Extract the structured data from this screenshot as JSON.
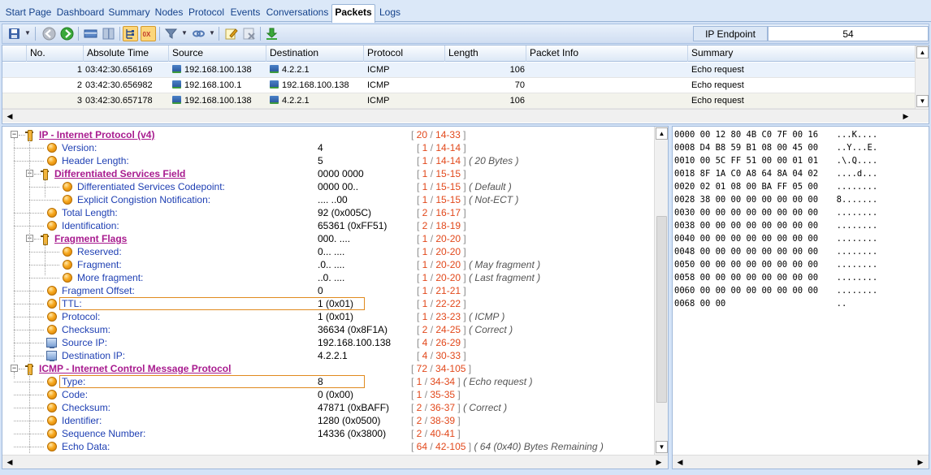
{
  "tabs": [
    {
      "label": "Start Page",
      "active": false
    },
    {
      "label": "Dashboard",
      "active": false
    },
    {
      "label": "Summary",
      "active": false
    },
    {
      "label": "Nodes",
      "active": false
    },
    {
      "label": "Protocol",
      "active": false
    },
    {
      "label": "Events",
      "active": false
    },
    {
      "label": "Conversations",
      "active": false
    },
    {
      "label": "Packets",
      "active": true
    },
    {
      "label": "Logs",
      "active": false
    }
  ],
  "toolbar": {
    "ip_endpoint_label": "IP Endpoint",
    "ip_endpoint_value": "54",
    "buttons": [
      "save-icon",
      "back-icon",
      "forward-icon",
      "panel-layout-icon",
      "columns-icon",
      "decode-view-icon",
      "hex-view-icon",
      "filter-icon",
      "link-icon",
      "edit-icon",
      "clear-icon",
      "download-icon"
    ]
  },
  "packets": {
    "columns": [
      "No.",
      "Absolute Time",
      "Source",
      "Destination",
      "Protocol",
      "Length",
      "Packet Info",
      "Summary"
    ],
    "rows": [
      {
        "no": "1",
        "time": "03:42:30.656169",
        "source": "192.168.100.138",
        "destination": "4.2.2.1",
        "protocol": "ICMP",
        "length": "106",
        "info": "",
        "summary": "Echo request"
      },
      {
        "no": "2",
        "time": "03:42:30.656982",
        "source": "192.168.100.1",
        "destination": "192.168.100.138",
        "protocol": "ICMP",
        "length": "70",
        "info": "",
        "summary": "Echo request"
      },
      {
        "no": "3",
        "time": "03:42:30.657178",
        "source": "192.168.100.138",
        "destination": "4.2.2.1",
        "protocol": "ICMP",
        "length": "106",
        "info": "",
        "summary": "Echo request"
      }
    ]
  },
  "decode": {
    "rows": [
      {
        "name": "IP - Internet Protocol (v4)",
        "value": "",
        "r1": "20",
        "r2": "14-33",
        "note": "",
        "kind": "hdr",
        "level": 0
      },
      {
        "name": "Version:",
        "value": "4",
        "r1": "1",
        "r2": "14-14",
        "note": "",
        "kind": "field",
        "level": 1
      },
      {
        "name": "Header Length:",
        "value": "5",
        "r1": "1",
        "r2": "14-14",
        "note": "( 20 Bytes )",
        "kind": "field",
        "level": 1
      },
      {
        "name": "Differentiated Services Field",
        "value": "0000 0000",
        "r1": "1",
        "r2": "15-15",
        "note": "",
        "kind": "hdr",
        "level": 1
      },
      {
        "name": "Differentiated Services Codepoint:",
        "value": "0000 00..",
        "r1": "1",
        "r2": "15-15",
        "note": "( Default )",
        "kind": "field",
        "level": 2
      },
      {
        "name": "Explicit Congistion Notification:",
        "value": ".... ..00",
        "r1": "1",
        "r2": "15-15",
        "note": "( Not-ECT )",
        "kind": "field",
        "level": 2
      },
      {
        "name": "Total Length:",
        "value": "92 (0x005C)",
        "r1": "2",
        "r2": "16-17",
        "note": "",
        "kind": "field",
        "level": 1
      },
      {
        "name": "Identification:",
        "value": "65361 (0xFF51)",
        "r1": "2",
        "r2": "18-19",
        "note": "",
        "kind": "field",
        "level": 1
      },
      {
        "name": "Fragment Flags",
        "value": "000. ....",
        "r1": "1",
        "r2": "20-20",
        "note": "",
        "kind": "hdr",
        "level": 1
      },
      {
        "name": "Reserved:",
        "value": "0... ....",
        "r1": "1",
        "r2": "20-20",
        "note": "",
        "kind": "field",
        "level": 2
      },
      {
        "name": "Fragment:",
        "value": ".0.. ....",
        "r1": "1",
        "r2": "20-20",
        "note": "( May fragment )",
        "kind": "field",
        "level": 2
      },
      {
        "name": "More fragment:",
        "value": "..0. ....",
        "r1": "1",
        "r2": "20-20",
        "note": "( Last fragment )",
        "kind": "field",
        "level": 2
      },
      {
        "name": "Fragment Offset:",
        "value": "0",
        "r1": "1",
        "r2": "21-21",
        "note": "",
        "kind": "field",
        "level": 1
      },
      {
        "name": "TTL:",
        "value": "1 (0x01)",
        "r1": "1",
        "r2": "22-22",
        "note": "",
        "kind": "field",
        "level": 1,
        "highlight": true
      },
      {
        "name": "Protocol:",
        "value": "1 (0x01)",
        "r1": "1",
        "r2": "23-23",
        "note": "( ICMP )",
        "kind": "field",
        "level": 1
      },
      {
        "name": "Checksum:",
        "value": "36634 (0x8F1A)",
        "r1": "2",
        "r2": "24-25",
        "note": "( Correct )",
        "kind": "field",
        "level": 1
      },
      {
        "name": "Source IP:",
        "value": "192.168.100.138",
        "r1": "4",
        "r2": "26-29",
        "note": "",
        "kind": "ip",
        "level": 1
      },
      {
        "name": "Destination IP:",
        "value": "4.2.2.1",
        "r1": "4",
        "r2": "30-33",
        "note": "",
        "kind": "ip",
        "level": 1
      },
      {
        "name": "ICMP - Internet Control Message Protocol",
        "value": "",
        "r1": "72",
        "r2": "34-105",
        "note": "",
        "kind": "hdr",
        "level": 0
      },
      {
        "name": "Type:",
        "value": "8",
        "r1": "1",
        "r2": "34-34",
        "note": "( Echo request )",
        "kind": "field",
        "level": 1,
        "highlight": true
      },
      {
        "name": "Code:",
        "value": "0 (0x00)",
        "r1": "1",
        "r2": "35-35",
        "note": "",
        "kind": "field",
        "level": 1
      },
      {
        "name": "Checksum:",
        "value": "47871 (0xBAFF)",
        "r1": "2",
        "r2": "36-37",
        "note": "( Correct )",
        "kind": "field",
        "level": 1
      },
      {
        "name": "Identifier:",
        "value": "1280 (0x0500)",
        "r1": "2",
        "r2": "38-39",
        "note": "",
        "kind": "field",
        "level": 1
      },
      {
        "name": "Sequence Number:",
        "value": "14336 (0x3800)",
        "r1": "2",
        "r2": "40-41",
        "note": "",
        "kind": "field",
        "level": 1
      },
      {
        "name": "Echo Data:",
        "value": "",
        "r1": "64",
        "r2": "42-105",
        "note": "( 64 (0x40) Bytes Remaining )",
        "kind": "field",
        "level": 1
      }
    ]
  },
  "hex": {
    "lines": [
      {
        "offset": "0000",
        "bytes": "00 12 80 4B C0 7F 00 16",
        "ascii": "...K...."
      },
      {
        "offset": "0008",
        "bytes": "D4 B8 59 B1 08 00 45 00",
        "ascii": "..Y...E."
      },
      {
        "offset": "0010",
        "bytes": "00 5C FF 51 00 00 01 01",
        "ascii": ".\\.Q...."
      },
      {
        "offset": "0018",
        "bytes": "8F 1A C0 A8 64 8A 04 02",
        "ascii": "....d..."
      },
      {
        "offset": "0020",
        "bytes": "02 01 08 00 BA FF 05 00",
        "ascii": "........"
      },
      {
        "offset": "0028",
        "bytes": "38 00 00 00 00 00 00 00",
        "ascii": "8......."
      },
      {
        "offset": "0030",
        "bytes": "00 00 00 00 00 00 00 00",
        "ascii": "........"
      },
      {
        "offset": "0038",
        "bytes": "00 00 00 00 00 00 00 00",
        "ascii": "........"
      },
      {
        "offset": "0040",
        "bytes": "00 00 00 00 00 00 00 00",
        "ascii": "........"
      },
      {
        "offset": "0048",
        "bytes": "00 00 00 00 00 00 00 00",
        "ascii": "........"
      },
      {
        "offset": "0050",
        "bytes": "00 00 00 00 00 00 00 00",
        "ascii": "........"
      },
      {
        "offset": "0058",
        "bytes": "00 00 00 00 00 00 00 00",
        "ascii": "........"
      },
      {
        "offset": "0060",
        "bytes": "00 00 00 00 00 00 00 00",
        "ascii": "........"
      },
      {
        "offset": "0068",
        "bytes": "00 00",
        "ascii": ".."
      }
    ]
  }
}
